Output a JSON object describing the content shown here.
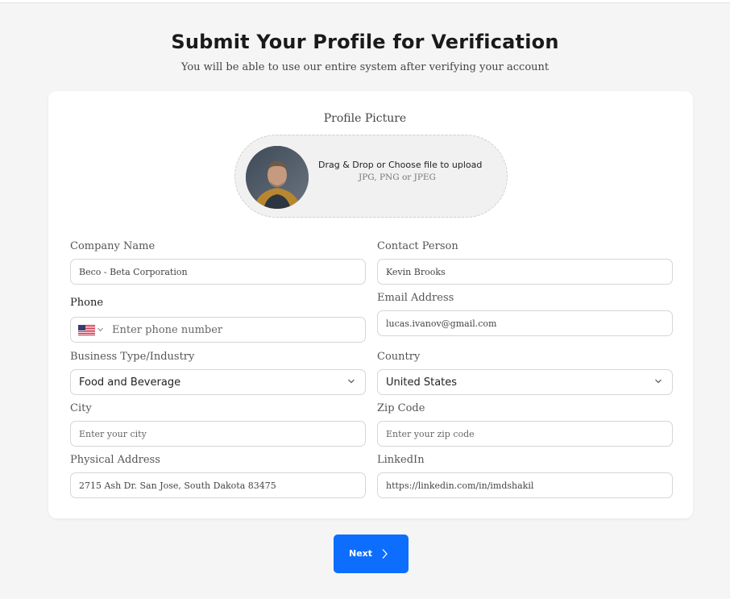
{
  "header": {
    "title": "Submit Your Profile for Verification",
    "subtitle": "You will be able to use our entire system after verifying your account"
  },
  "profile_picture": {
    "label": "Profile Picture",
    "upload_text": "Drag & Drop or Choose file to upload",
    "formats": "JPG, PNG or JPEG"
  },
  "form": {
    "company_name": {
      "label": "Company Name",
      "value": "Beco - Beta Corporation"
    },
    "contact_person": {
      "label": "Contact Person",
      "value": "Kevin Brooks"
    },
    "phone": {
      "label": "Phone",
      "placeholder": "Enter phone number",
      "country_flag": "us-flag-icon"
    },
    "email": {
      "label": "Email Address",
      "value": "lucas.ivanov@gmail.com"
    },
    "business_type": {
      "label": "Business Type/Industry",
      "value": "Food and Beverage"
    },
    "country": {
      "label": "Country",
      "value": "United States"
    },
    "city": {
      "label": "City",
      "placeholder": "Enter your city"
    },
    "zip": {
      "label": "Zip Code",
      "placeholder": "Enter your zip code"
    },
    "address": {
      "label": "Physical Address",
      "value": "2715 Ash Dr. San Jose, South Dakota 83475"
    },
    "linkedin": {
      "label": "LinkedIn",
      "value": "https://linkedin.com/in/imdshakil"
    }
  },
  "actions": {
    "next_label": "Next"
  },
  "colors": {
    "accent": "#0d6efd",
    "background": "#f5f5f5",
    "card": "#ffffff"
  }
}
